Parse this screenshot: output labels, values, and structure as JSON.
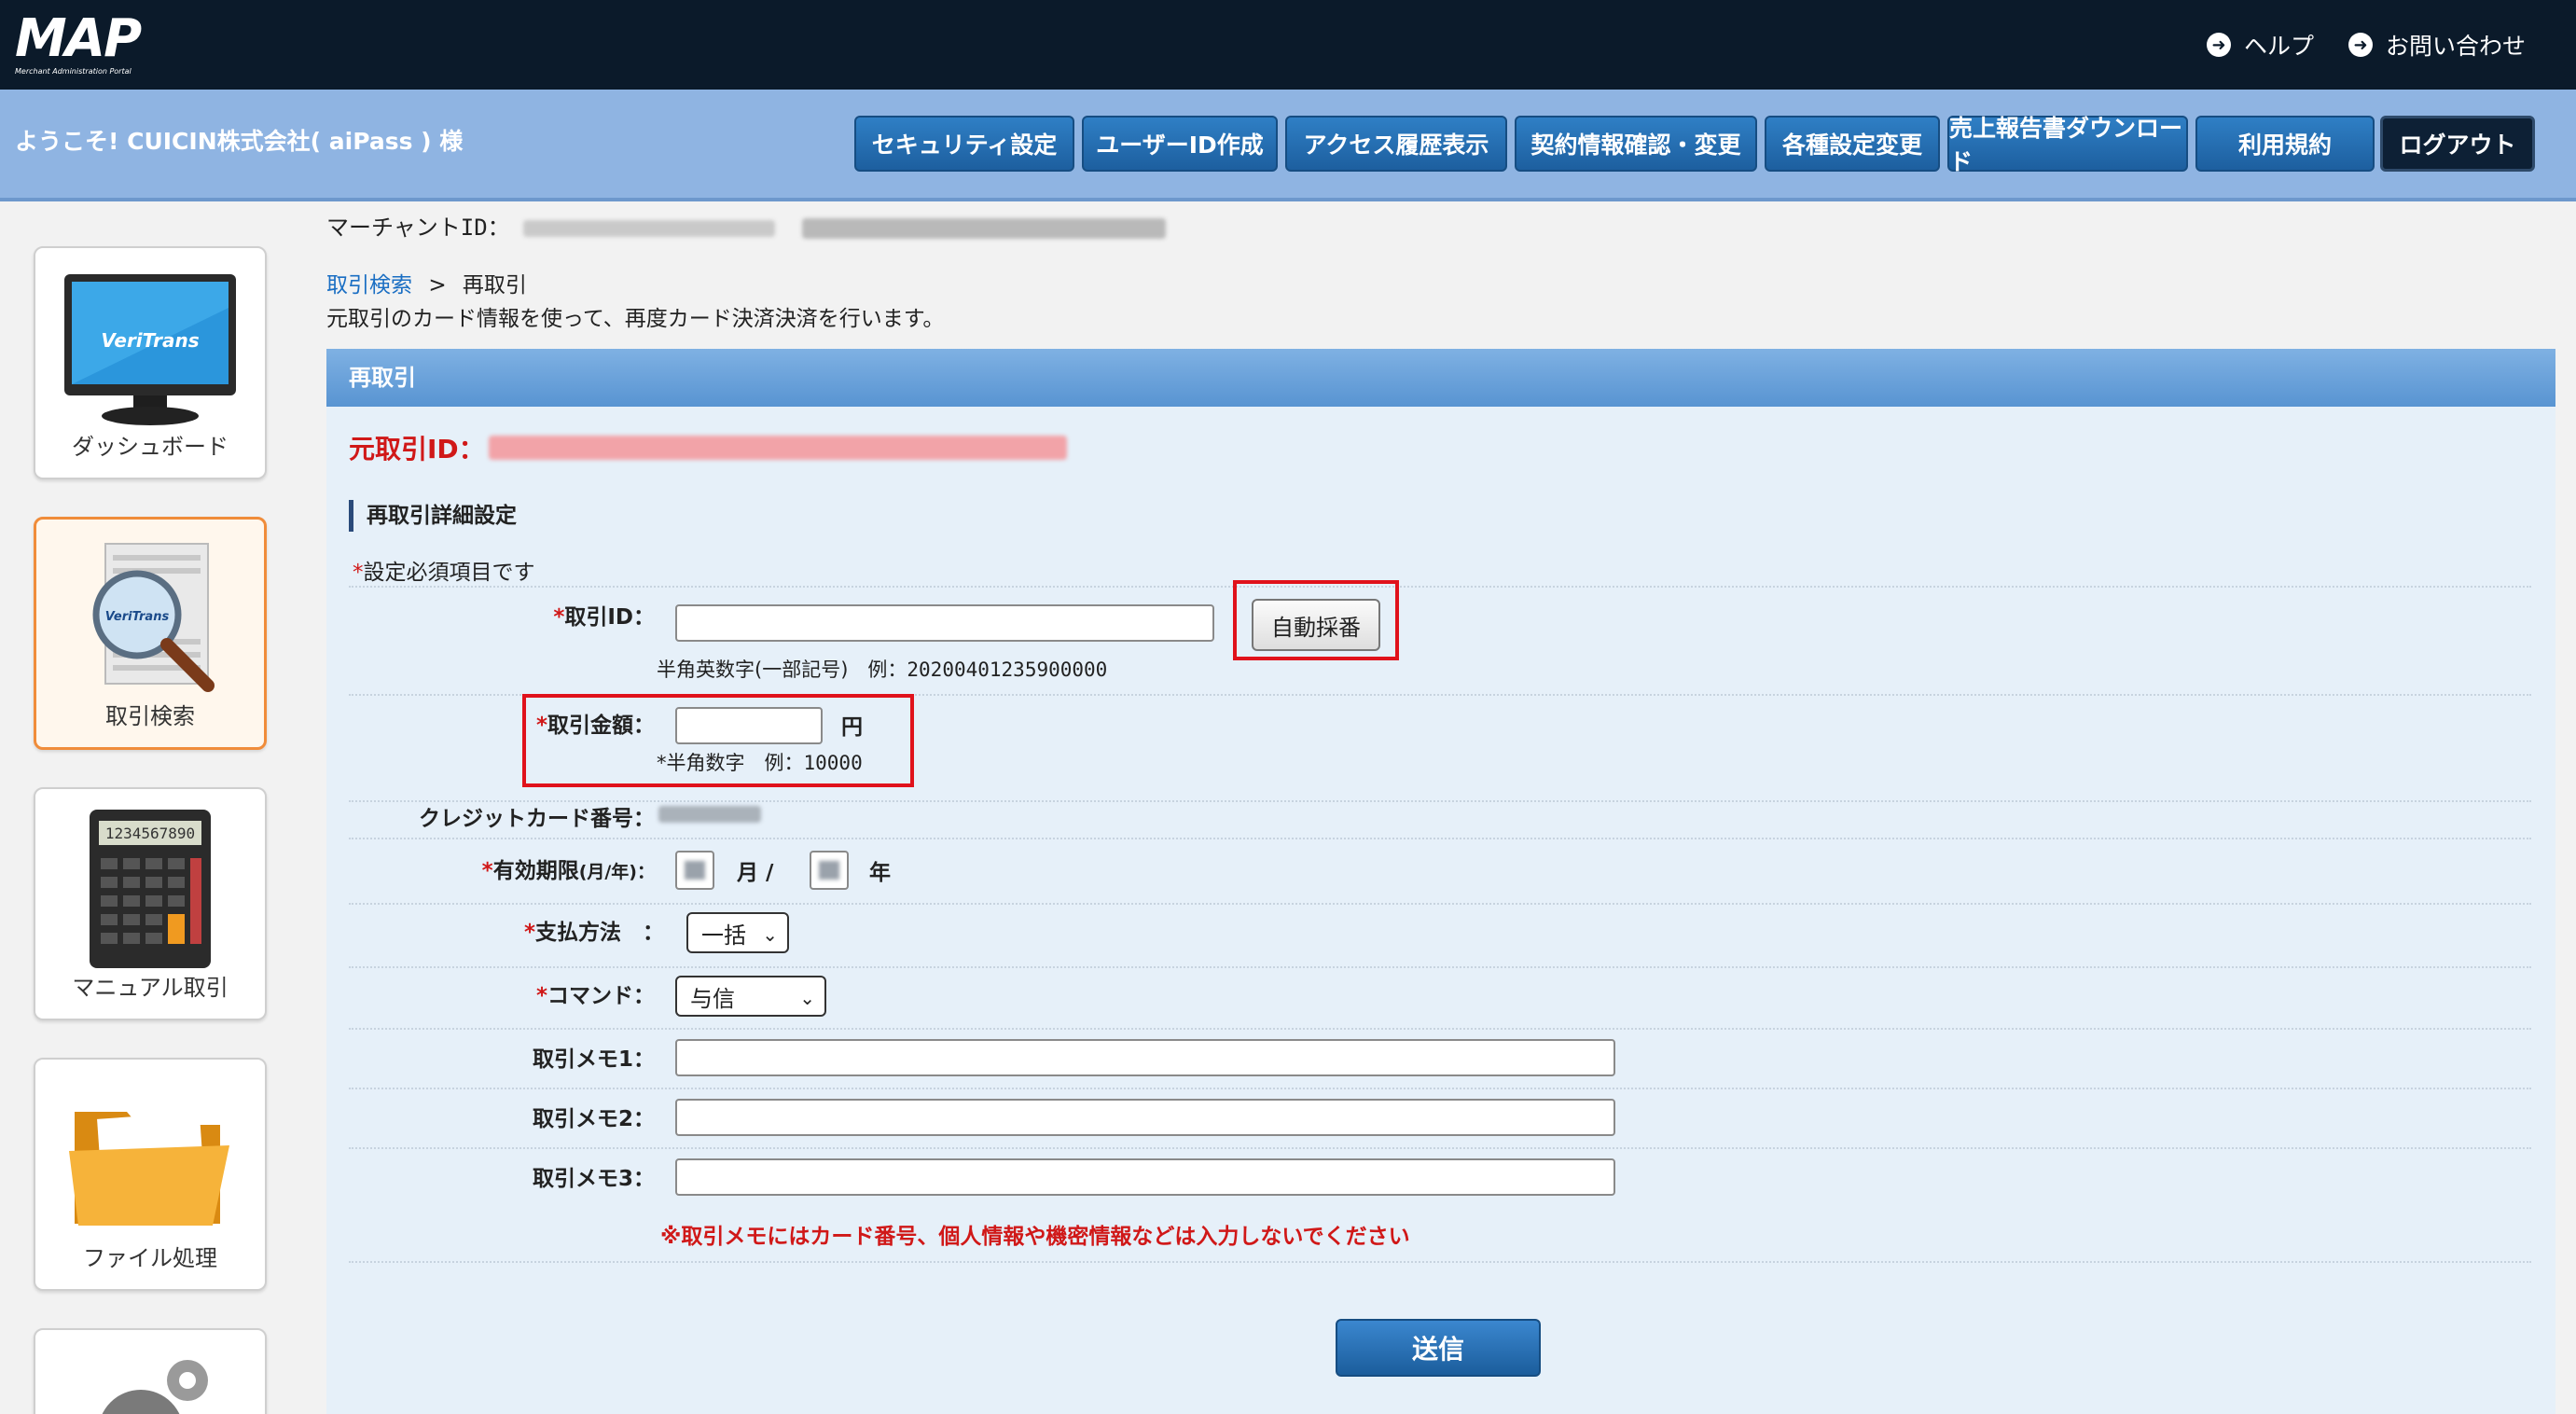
{
  "app": {
    "logo_text": "MAP",
    "logo_subtitle": "Merchant Administration Portal"
  },
  "toplinks": {
    "help": "ヘルプ",
    "contact": "お問い合わせ"
  },
  "header": {
    "welcome": "ようこそ! CUICIN株式会社( aiPass ) 様",
    "nav": [
      {
        "label": "セキュリティ設定"
      },
      {
        "label": "ユーザーID作成"
      },
      {
        "label": "アクセス履歴表示"
      },
      {
        "label": "契約情報確認・変更"
      },
      {
        "label": "各種設定変更"
      },
      {
        "label": "売上報告書ダウンロード"
      },
      {
        "label": "利用規約"
      },
      {
        "label": "ログアウト"
      }
    ]
  },
  "merchant": {
    "label": "マーチャントID："
  },
  "sidebar": {
    "items": [
      {
        "label": "ダッシュボード",
        "icon": "monitor-icon",
        "icon_text": "VeriTrans"
      },
      {
        "label": "取引検索",
        "icon": "search-document-icon",
        "icon_text": "VeriTrans"
      },
      {
        "label": "マニュアル取引",
        "icon": "calculator-icon",
        "icon_text": "1234567890"
      },
      {
        "label": "ファイル処理",
        "icon": "folder-icon"
      },
      {
        "label": "",
        "icon": "gear-icon"
      }
    ]
  },
  "breadcrumb": {
    "link": "取引検索",
    "separator": ">",
    "current": "再取引"
  },
  "description": "元取引のカード情報を使って、再度カード決済決済を行います。",
  "panel": {
    "title": "再取引",
    "original_id_label": "元取引ID：",
    "section_title": "再取引詳細設定",
    "required_note": "設定必須項目です",
    "required_mark": "*"
  },
  "form": {
    "transaction_id": {
      "label": "取引ID：",
      "value": "",
      "auto_button": "自動採番",
      "hint_prefix": "半角英数字(一部記号)　例：",
      "hint_example": "20200401235900000"
    },
    "amount": {
      "label": "取引金額：",
      "value": "",
      "unit": "円",
      "hint_prefix": "*半角数字　例：",
      "hint_example": "10000"
    },
    "card_number": {
      "label": "クレジットカード番号："
    },
    "expiry": {
      "label": "有効期限",
      "label_suffix": "(月/年)：",
      "month_unit": "月 /",
      "year_unit": "年"
    },
    "payment_method": {
      "label": "支払方法　：",
      "value": "一括"
    },
    "command": {
      "label": "コマンド：",
      "value": "与信"
    },
    "memo1": {
      "label": "取引メモ1：",
      "value": ""
    },
    "memo2": {
      "label": "取引メモ2：",
      "value": ""
    },
    "memo3": {
      "label": "取引メモ3：",
      "value": ""
    },
    "warning": "※取引メモにはカード番号、個人情報や機密情報などは入力しないでください",
    "submit": "送信"
  },
  "colors": {
    "topbar": "#0b1a2a",
    "header": "#8fb4e2",
    "panel": "#e6f0f9",
    "accent_red": "#d01818",
    "button_blue": "#1d5f9f"
  }
}
